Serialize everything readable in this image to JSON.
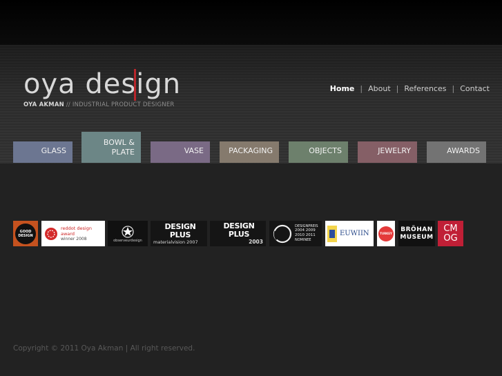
{
  "logo": {
    "title": "oya design",
    "subtitle_name": "OYA AKMAN",
    "subtitle_rest": "// INDUSTRIAL PRODUCT DESIGNER"
  },
  "nav": {
    "items": [
      "Home",
      "About",
      "References",
      "Contact"
    ],
    "separator": "|",
    "active": "Home"
  },
  "categories": [
    {
      "label": "GLASS",
      "color": "#6c7691"
    },
    {
      "label": "BOWL & PLATE",
      "color": "#6c8686"
    },
    {
      "label": "VASE",
      "color": "#7a6a85"
    },
    {
      "label": "PACKAGING",
      "color": "#857a6d"
    },
    {
      "label": "OBJECTS",
      "color": "#6d806c"
    },
    {
      "label": "JEWELRY",
      "color": "#855f66"
    },
    {
      "label": "AWARDS",
      "color": "#737373"
    }
  ],
  "awards": [
    {
      "label_1": "GOOD",
      "label_2": "DESIGN",
      "icon": "good-design-logo"
    },
    {
      "label_1": "reddot design award",
      "label_2": "winner 2008",
      "icon": "reddot-logo"
    },
    {
      "label_1": "observeurdesign",
      "icon": "observeur-star-logo"
    },
    {
      "label_1": "DESIGN PLUS",
      "label_2": "materialvision 2007"
    },
    {
      "label_1": "DESIGN PLUS",
      "label_2": "2003"
    },
    {
      "label_1": "DESIGNPREIS",
      "label_2": "2004 2009",
      "label_3": "2010 2011",
      "label_4": "NOMINEE",
      "icon": "designpreis-ring-logo"
    },
    {
      "label_1": "EUWIIN",
      "icon": "euwiin-logo"
    },
    {
      "label_1": "TURKEY",
      "icon": "turkey-award-logo"
    },
    {
      "label_1": "BRÖHAN",
      "label_2": "MUSEUM"
    },
    {
      "label_1": "CM",
      "label_2": "OG"
    }
  ],
  "footer": {
    "text": "Copyright © 2011 Oya Akman | All right reserved."
  }
}
